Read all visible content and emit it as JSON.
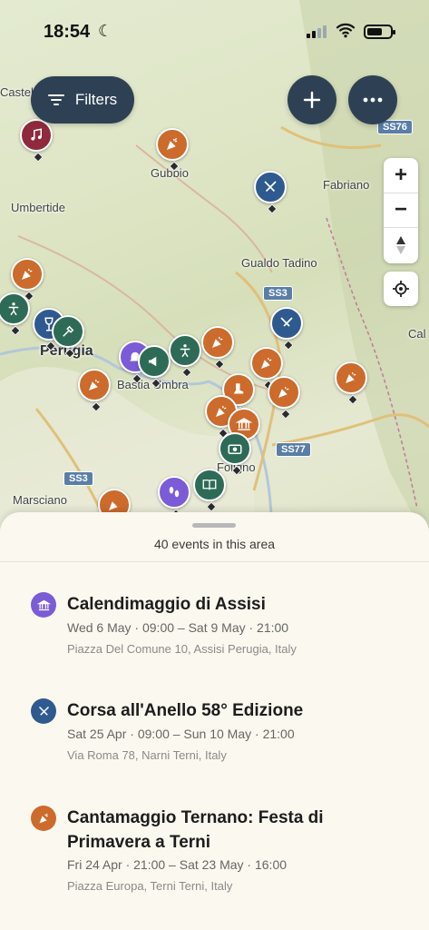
{
  "status": {
    "time": "18:54"
  },
  "map": {
    "filters_label": "Filters",
    "zoom_in": "+",
    "zoom_out": "−",
    "places": [
      "Castello",
      "Gubbio",
      "Umbertide",
      "Fabriano",
      "Gualdo Tadino",
      "Perugia",
      "Bastia Umbra",
      "Foligno",
      "Marsciano",
      "Cal"
    ],
    "roads": [
      "SS76",
      "SS3",
      "SS77",
      "SS3"
    ]
  },
  "sheet": {
    "count": "40 events in this area",
    "events": [
      {
        "title": "Calendimaggio di Assisi",
        "when": "Wed 6 May · 09:00 – Sat 9 May · 21:00",
        "where": "Piazza Del Comune 10, Assisi Perugia, Italy",
        "icon": "museum-icon",
        "color": "#7c5bd6"
      },
      {
        "title": "Corsa all'Anello 58° Edizione",
        "when": "Sat 25 Apr · 09:00 – Sun 10 May · 21:00",
        "where": "Via Roma 78, Narni Terni, Italy",
        "icon": "swords-icon",
        "color": "#2f5a8f"
      },
      {
        "title": "Cantamaggio Ternano: Festa di Primavera a Terni",
        "when": "Fri 24 Apr · 21:00 – Sat 23 May · 16:00",
        "where": "Piazza Europa, Terni Terni, Italy",
        "icon": "party-icon",
        "color": "#cc6b2c"
      }
    ]
  }
}
